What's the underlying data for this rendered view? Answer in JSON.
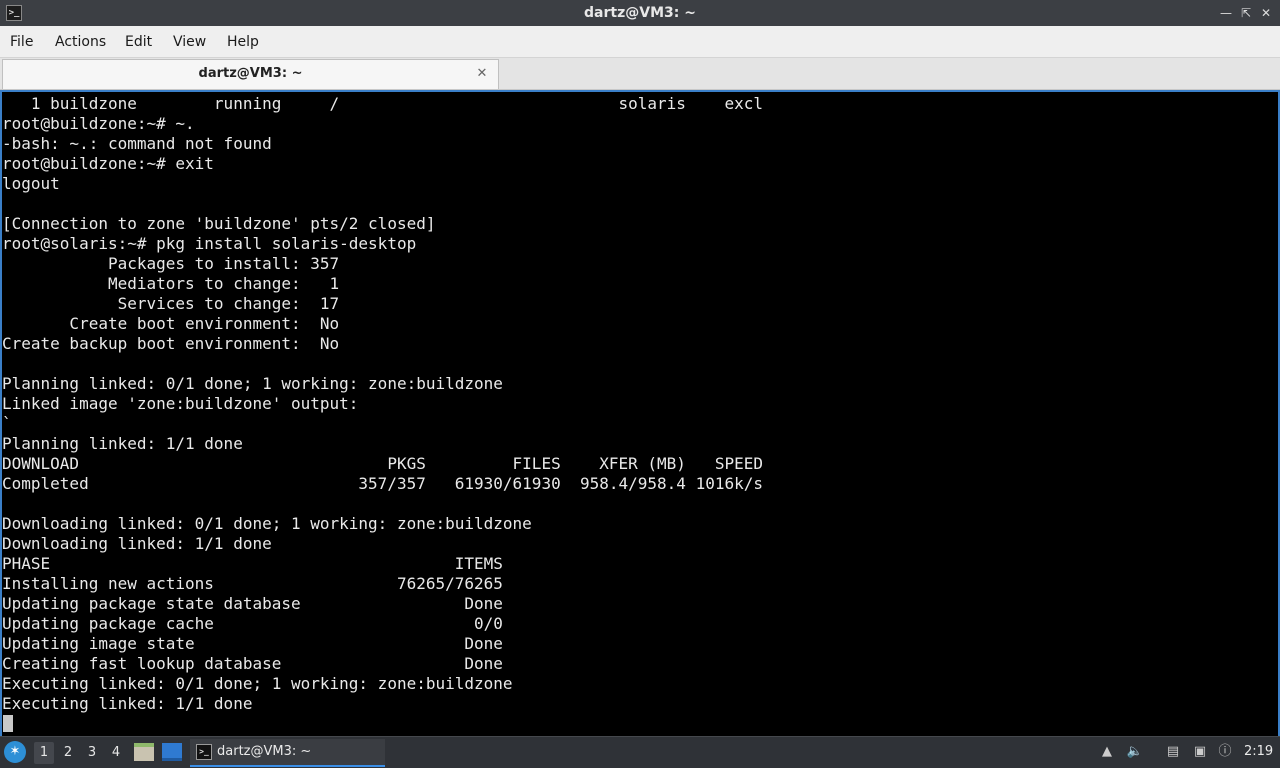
{
  "window": {
    "title": "dartz@VM3: ~",
    "controls": {
      "minimize_icon": "minimize-icon",
      "maximize_icon": "maximize-icon",
      "close_icon": "close-icon"
    }
  },
  "menubar": {
    "items": [
      {
        "label": "File"
      },
      {
        "label": "Actions"
      },
      {
        "label": "Edit"
      },
      {
        "label": "View"
      },
      {
        "label": "Help"
      }
    ]
  },
  "tabs": [
    {
      "label": "dartz@VM3: ~",
      "active": true
    }
  ],
  "terminal": {
    "lines": [
      "   1 buildzone        running     /                             solaris    excl",
      "root@buildzone:~# ~.",
      "-bash: ~.: command not found",
      "root@buildzone:~# exit",
      "logout",
      "",
      "[Connection to zone 'buildzone' pts/2 closed]",
      "root@solaris:~# pkg install solaris-desktop",
      "           Packages to install: 357",
      "           Mediators to change:   1",
      "            Services to change:  17",
      "       Create boot environment:  No",
      "Create backup boot environment:  No",
      "",
      "Planning linked: 0/1 done; 1 working: zone:buildzone",
      "Linked image 'zone:buildzone' output:",
      "`",
      "Planning linked: 1/1 done",
      "DOWNLOAD                                PKGS         FILES    XFER (MB)   SPEED",
      "Completed                            357/357   61930/61930  958.4/958.4 1016k/s",
      "",
      "Downloading linked: 0/1 done; 1 working: zone:buildzone",
      "Downloading linked: 1/1 done",
      "PHASE                                          ITEMS",
      "Installing new actions                   76265/76265",
      "Updating package state database                 Done",
      "Updating package cache                           0/0",
      "Updating image state                            Done",
      "Creating fast lookup database                   Done",
      "Executing linked: 0/1 done; 1 working: zone:buildzone",
      "Executing linked: 1/1 done"
    ],
    "colors": {
      "background": "#000000",
      "foreground": "#e9e9e9",
      "border": "#3a7fc8"
    }
  },
  "taskbar": {
    "workspaces": [
      "1",
      "2",
      "3",
      "4"
    ],
    "active_workspace": "1",
    "task_label": "dartz@VM3: ~",
    "clock": "2:19",
    "tray_icons": [
      "upload-icon",
      "volume-icon",
      "clipboard-icon",
      "network-icon",
      "updates-icon"
    ]
  }
}
